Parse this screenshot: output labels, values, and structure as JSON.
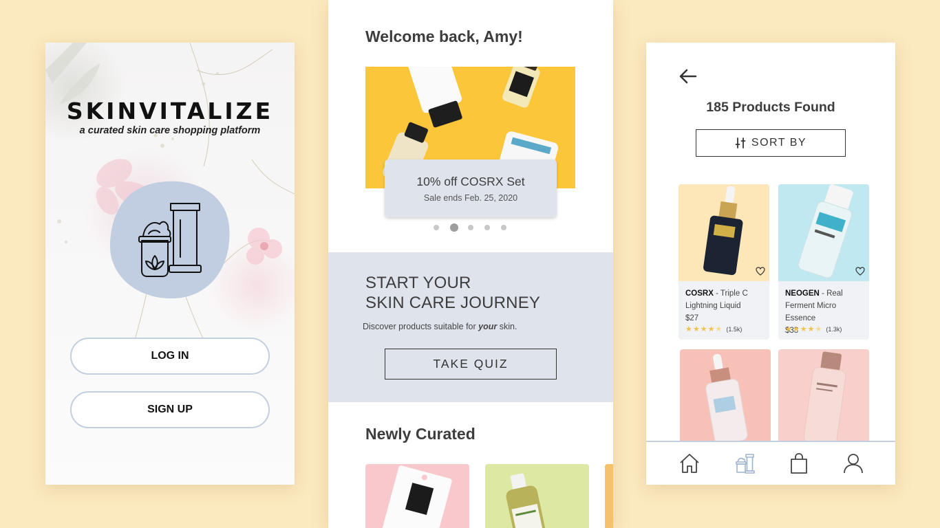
{
  "colors": {
    "background": "#fbe9bf",
    "accent_blue": "#c3cfe0",
    "panel": "#dfe3ec",
    "banner_yellow": "#fcc63a",
    "star": "#f0c24b",
    "text": "#3d3d3d"
  },
  "login_screen": {
    "brand": "SKINVITALIZE",
    "tagline": "a curated skin care shopping platform",
    "logo_icon": "skincare-products-icon",
    "login_label": "LOG IN",
    "signup_label": "SIGN UP"
  },
  "home_screen": {
    "welcome": "Welcome back, Amy!",
    "promo": {
      "title": "10% off COSRX Set",
      "subtitle": "Sale ends Feb. 25, 2020"
    },
    "carousel": {
      "count": 5,
      "active_index": 1
    },
    "journey": {
      "title_line1": "START YOUR",
      "title_line2": "SKIN CARE JOURNEY",
      "subtitle_before": "Discover products suitable for ",
      "subtitle_emphasis": "your",
      "subtitle_after": " skin.",
      "button_label": "TAKE QUIZ"
    },
    "newly_title": "Newly Curated"
  },
  "results_screen": {
    "back_icon": "back-arrow-icon",
    "found_label": "185 Products Found",
    "sort_label": "SORT BY",
    "sort_icon": "sliders-icon",
    "products": [
      {
        "brand": "COSRX",
        "name_suffix": " - Triple C",
        "name_line2": "Lightning Liquid",
        "price": "$27",
        "rating": 4.5,
        "reviews": "(1.5k)",
        "image_bg": "#fde6b8"
      },
      {
        "brand": "NEOGEN",
        "name_suffix": " - Real",
        "name_line2": "Ferment Micro Essence",
        "price": "$38",
        "rating": 4.5,
        "reviews": "(1.3k)",
        "image_bg": "#bfe8f0"
      }
    ],
    "more_products_bg": [
      "#f7c1b8",
      "#f8cfcb"
    ],
    "tabs": [
      "home-icon",
      "products-icon",
      "shopping-bag-icon",
      "profile-icon"
    ],
    "active_tab": 1
  }
}
